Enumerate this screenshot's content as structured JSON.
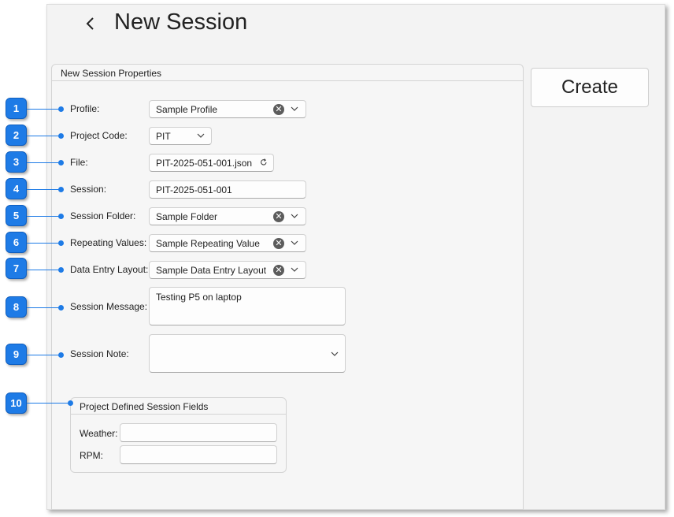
{
  "header": {
    "back_icon": "chevron-left-icon",
    "title": "New Session"
  },
  "group": {
    "title": "New Session Properties"
  },
  "create_label": "Create",
  "fields": {
    "profile": {
      "label": "Profile:",
      "value": "Sample Profile"
    },
    "project_code": {
      "label": "Project Code:",
      "value": "PIT"
    },
    "file": {
      "label": "File:",
      "value": "PIT-2025-051-001.json"
    },
    "session": {
      "label": "Session:",
      "value": "PIT-2025-051-001"
    },
    "session_folder": {
      "label": "Session Folder:",
      "value": "Sample Folder"
    },
    "repeating_values": {
      "label": "Repeating Values:",
      "value": "Sample Repeating Value"
    },
    "data_entry_layout": {
      "label": "Data Entry Layout:",
      "value": "Sample Data Entry Layout"
    },
    "session_message": {
      "label": "Session Message:",
      "value": "Testing P5 on laptop"
    },
    "session_note": {
      "label": "Session Note:",
      "value": ""
    }
  },
  "project_fields": {
    "title": "Project Defined Session Fields",
    "weather": {
      "label": "Weather:",
      "value": ""
    },
    "rpm": {
      "label": "RPM:",
      "value": ""
    }
  },
  "callouts": [
    "1",
    "2",
    "3",
    "4",
    "5",
    "6",
    "7",
    "8",
    "9",
    "10"
  ],
  "colors": {
    "callout": "#1e7be6",
    "window_bg": "#f3f3f3",
    "clear_icon": "#5c5c5c"
  },
  "icons": {
    "clear": "clear-circle-icon",
    "dropdown": "chevron-down-icon",
    "refresh": "refresh-icon"
  }
}
